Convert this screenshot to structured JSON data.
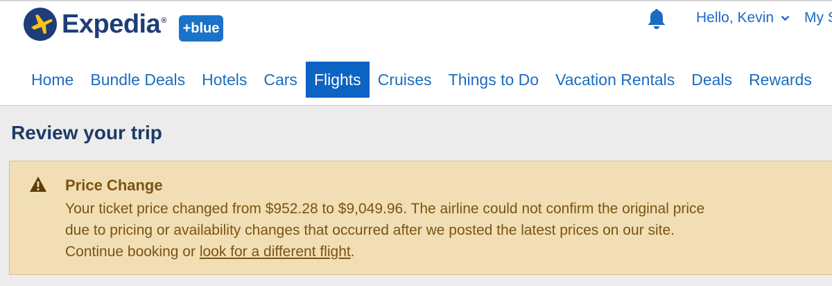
{
  "header": {
    "brand": "Expedia",
    "brand_mark": "®",
    "loyalty_badge": "+blue",
    "greeting": "Hello, Kevin",
    "account_link": "My S"
  },
  "nav": {
    "items": [
      {
        "label": "Home",
        "active": false
      },
      {
        "label": "Bundle Deals",
        "active": false
      },
      {
        "label": "Hotels",
        "active": false
      },
      {
        "label": "Cars",
        "active": false
      },
      {
        "label": "Flights",
        "active": true
      },
      {
        "label": "Cruises",
        "active": false
      },
      {
        "label": "Things to Do",
        "active": false
      },
      {
        "label": "Vacation Rentals",
        "active": false
      },
      {
        "label": "Deals",
        "active": false
      },
      {
        "label": "Rewards",
        "active": false
      }
    ]
  },
  "page": {
    "title": "Review your trip"
  },
  "alert": {
    "title": "Price Change",
    "line1": "Your ticket price changed from $952.28 to $9,049.96. The airline could not confirm the original price",
    "line2": "due to pricing or availability changes that occurred after we posted the latest prices on our site.",
    "line3_prefix": "Continue booking or ",
    "link": "look for a different flight",
    "line3_suffix": "."
  },
  "colors": {
    "brand_navy": "#1e3c78",
    "link_blue": "#1a6cc2",
    "active_tab": "#0b63c4",
    "alert_bg": "#f1deb5",
    "alert_text": "#7a5410"
  },
  "icons": [
    "globe-logo-icon",
    "bell-icon",
    "chevron-down-icon",
    "warning-icon"
  ]
}
